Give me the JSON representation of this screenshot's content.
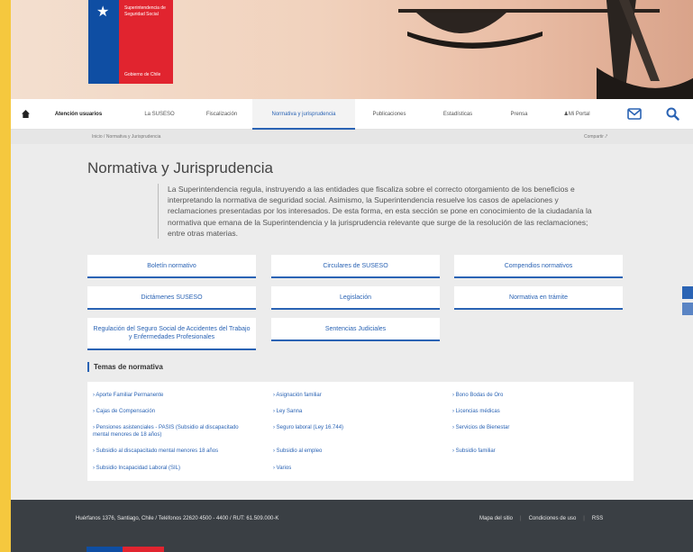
{
  "logo": {
    "name": "Superintendencia de Seguridad Social",
    "government": "Gobierno de Chile"
  },
  "nav": {
    "items": [
      {
        "label": "Atención usuarios"
      },
      {
        "label": "La SUSESO"
      },
      {
        "label": "Fiscalización"
      },
      {
        "label": "Normativa y jurisprudencia"
      },
      {
        "label": "Publicaciones"
      },
      {
        "label": "Estadísticas"
      },
      {
        "label": "Prensa"
      },
      {
        "label": "Mi Portal"
      }
    ],
    "active_item": "Normativa y jurisprudencia"
  },
  "breadcrumb": {
    "text": "Inicio  /  Normativa y Jurisprudencia",
    "share": "Compartir"
  },
  "page": {
    "title": "Normativa y Jurisprudencia",
    "intro": "La Superintendencia regula, instruyendo a las entidades que fiscaliza sobre el correcto otorgamiento de los beneficios e interpretando la normativa de seguridad social. Asimismo, la Superintendencia resuelve los casos de apelaciones y reclamaciones presentadas por los interesados. De esta forma, en esta sección se pone en conocimiento de la ciudadanía la normativa que emana de la Superintendencia y la jurisprudencia relevante que surge de la resolución de las reclamaciones; entre otras materias."
  },
  "buttons": [
    {
      "label": "Boletín normativo"
    },
    {
      "label": "Circulares de SUSESO"
    },
    {
      "label": "Compendios normativos"
    },
    {
      "label": "Dictámenes SUSESO"
    },
    {
      "label": "Legislación"
    },
    {
      "label": "Normativa en trámite"
    },
    {
      "label": "Regulación del Seguro Social de Accidentes del Trabajo y Enfermedades Profesionales"
    },
    {
      "label": "Sentencias Judiciales"
    }
  ],
  "temas": {
    "heading": "Temas de normativa",
    "items": [
      "› Aporte Familiar Permanente",
      "› Asignación familiar",
      "› Bono Bodas de Oro",
      "› Cajas de Compensación",
      "› Ley Sanna",
      "› Licencias médicas",
      "› Pensiones asistenciales - PASIS (Subsidio al discapacitado mental menores de 18 años)",
      "› Seguro laboral (Ley 16.744)",
      "› Servicios de Bienestar",
      "› Subsidio al discapacitado mental menores 18 años",
      "› Subsidio al empleo",
      "› Subsidio familiar",
      "› Subsidio Incapacidad Laboral (SIL)",
      "› Varios"
    ]
  },
  "footer": {
    "address": "Huérfanos 1376, Santiago, Chile / Teléfonos 22620 4500 - 4400 / RUT: 61.509.000-K",
    "links": [
      "Mapa del sitio",
      "Condiciones de uso",
      "RSS"
    ]
  },
  "colors": {
    "accent": "#2a63b4",
    "footer": "#3a3f44",
    "border": "#f5c83e",
    "chile_blue": "#0f4ea3",
    "chile_red": "#e1242f"
  }
}
